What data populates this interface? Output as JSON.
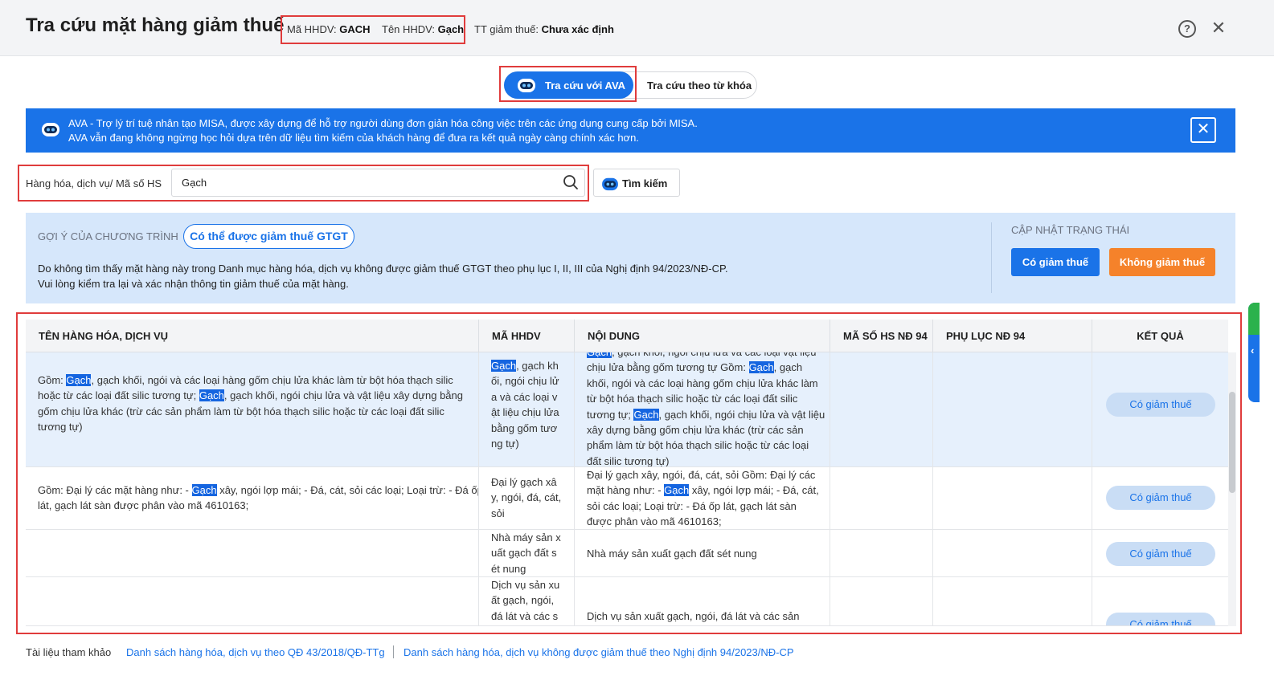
{
  "header": {
    "title": "Tra cứu mặt hàng giảm thuế",
    "code_label": "Mã HHDV:",
    "code_value": "GACH",
    "name_label": "Tên HHDV:",
    "name_value": "Gạch",
    "status_label": "TT giảm thuế:",
    "status_value": "Chưa xác định",
    "help_glyph": "?",
    "close_glyph": "✕"
  },
  "mode_tabs": {
    "ava_label": "Tra cứu với AVA",
    "keyword_label": "Tra cứu theo từ khóa",
    "active": "ava"
  },
  "banner": {
    "line1": "AVA - Trợ lý trí tuệ nhân tạo MISA, được xây dựng để hỗ trợ người dùng đơn giản hóa công việc trên các ứng dụng cung cấp bởi MISA.",
    "line2": "AVA vẫn đang không ngừng học hỏi dựa trên dữ liệu tìm kiếm của khách hàng để đưa ra kết quả ngày càng chính xác hơn.",
    "close_glyph": "✕"
  },
  "search": {
    "label": "Hàng hóa, dịch vụ/ Mã số HS",
    "value": "Gạch",
    "button_label": "Tìm kiếm"
  },
  "suggestion": {
    "caption": "GỢI Ý CỦA CHƯƠNG TRÌNH",
    "pill": "Có thể được giảm thuế GTGT",
    "desc_line1": "Do không tìm thấy mặt hàng này trong Danh mục hàng hóa, dịch vụ không được giảm thuế GTGT theo phụ lục I, II, III của Nghị định 94/2023/NĐ-CP.",
    "desc_line2": "Vui lòng kiểm tra lại và xác nhận thông tin giảm thuế của mặt hàng.",
    "update_caption": "CẬP NHẬT TRẠNG THÁI",
    "btn_yes": "Có giảm thuế",
    "btn_no": "Không giảm thuế"
  },
  "table": {
    "columns": [
      "TÊN HÀNG HÓA, DỊCH VỤ",
      "MÃ HHDV",
      "NỘI DUNG",
      "MÃ SỐ HS NĐ 94",
      "PHỤ LỤC NĐ 94",
      "KẾT QUẢ"
    ],
    "rows": [
      {
        "name_lines": [
          [
            "Gồm: ",
            "[Gạch]",
            ", gạch khối, ngói và các loại hàng gốm chịu lửa khác làm từ bột hóa thạch silic"
          ],
          [
            "hoặc từ các loại đất silic tương tự; ",
            "[Gạch]",
            ", gạch khối, ngói chịu lửa và vật liệu xây dựng bằng"
          ],
          [
            "gốm chịu lửa khác (trừ các sản phẩm làm từ bột hóa thạch silic hoặc từ các loại đất silic"
          ],
          [
            "tương tự)"
          ]
        ],
        "code_lines": [
          [
            "[Gạch]",
            ", gạch kh"
          ],
          [
            "ối, ngói chịu lử"
          ],
          [
            "a và các loại v"
          ],
          [
            "ật liệu chịu lửa"
          ],
          [
            "bằng gốm tươ"
          ],
          [
            "ng tự)"
          ]
        ],
        "content_lines": [
          [
            "[Gạch]",
            ", gạch khối, ngói chịu lửa và các loại vật liệu"
          ],
          [
            "chịu lửa bằng gốm tương tự Gồm: ",
            "[Gạch]",
            ", gạch"
          ],
          [
            "khối, ngói và các loại hàng gốm chịu lửa khác làm"
          ],
          [
            "từ bột hóa thạch silic hoặc từ các loại đất silic"
          ],
          [
            "tương tự; ",
            "[Gạch]",
            ", gạch khối, ngói chịu lửa và vật liệu"
          ],
          [
            "xây dựng bằng gốm chịu lửa khác (trừ các sản"
          ],
          [
            "phẩm làm từ bột hóa thạch silic hoặc từ các loại"
          ],
          [
            "đất silic tương tự)"
          ]
        ],
        "hs_code": "",
        "appendix": "",
        "result": "Có giảm thuế"
      },
      {
        "name_lines": [
          [
            "Gồm: Đại lý các mặt hàng như: - ",
            "[Gạch]",
            " xây, ngói lợp mái; - Đá, cát, sỏi các loại; Loại trừ: - Đá ốp"
          ],
          [
            "lát, gạch lát sàn được phân vào mã 4610163;"
          ]
        ],
        "code_lines": [
          [
            "Đại lý gạch xâ"
          ],
          [
            "y, ngói, đá, cát,"
          ],
          [
            "sỏi"
          ]
        ],
        "content_lines": [
          [
            "Đại lý gạch xây, ngói, đá, cát, sỏi Gồm: Đại lý các"
          ],
          [
            "mặt hàng như: - ",
            "[Gạch]",
            " xây, ngói lợp mái; - Đá, cát,"
          ],
          [
            "sỏi các loại; Loại trừ: - Đá ốp lát, gạch lát sàn"
          ],
          [
            "được phân vào mã 4610163;"
          ]
        ],
        "hs_code": "",
        "appendix": "",
        "result": "Có giảm thuế"
      },
      {
        "name_lines": [],
        "code_lines": [
          [
            "Nhà máy sản x"
          ],
          [
            "uất gạch đất s"
          ],
          [
            "ét nung"
          ]
        ],
        "content_lines": [
          [
            "Nhà máy sản xuất gạch đất sét nung"
          ]
        ],
        "hs_code": "",
        "appendix": "",
        "result": "Có giảm thuế"
      },
      {
        "name_lines": [],
        "code_lines": [
          [
            "Dịch vụ sản xu"
          ],
          [
            "ất gạch, ngói,"
          ],
          [
            "đá lát và các s"
          ]
        ],
        "content_lines": [
          [
            "Dịch vụ sản xuất gạch, ngói, đá lát và các sản"
          ]
        ],
        "hs_code": "",
        "appendix": "",
        "result": "Có giảm thuế"
      }
    ]
  },
  "footer": {
    "label": "Tài liệu tham khảo",
    "link1": "Danh sách hàng hóa, dịch vụ theo QĐ 43/2018/QĐ-TTg",
    "link2": "Danh sách hàng hóa, dịch vụ không được giảm thuế theo Nghị định 94/2023/NĐ-CP"
  },
  "colors": {
    "accent": "#1a73e8",
    "warning": "#f5822a",
    "highlight_box": "#e03c3c",
    "selected_row": "#e6f0fc"
  }
}
